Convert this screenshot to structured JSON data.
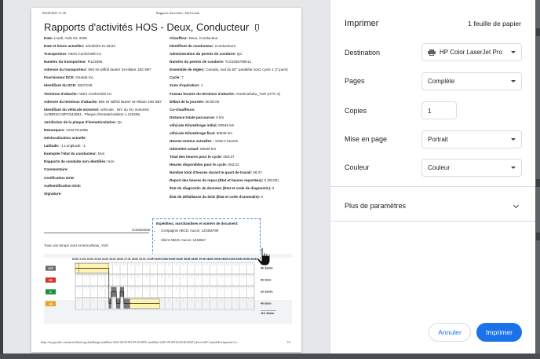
{
  "sheet": {
    "header_left": "04/08/2025 11:26",
    "header_center": "Rapports d'activités | MyGeotab",
    "title": "Rapports d'activités HOS - Deux, Conducteur",
    "left_rows": [
      {
        "k": "Date:",
        "v": " Lundi, Août 04, 2025"
      },
      {
        "k": "Date et heure actuelles:",
        "v": " 4/août/25 11:18:04"
      },
      {
        "k": "Transporteur:",
        "v": " AttriX Conformité inc"
      },
      {
        "k": "Numéro du transporteur:",
        "v": " R123456"
      },
      {
        "k": "Adresse du transporteur:",
        "v": " 894 sir wilfrid laurier St-Hilaire J3G 6B7"
      },
      {
        "k": "Fournisseur DCE:",
        "v": " Geotab Inc."
      },
      {
        "k": "Identifiant du DCE:",
        "v": " GEOTAB"
      },
      {
        "k": "Terminus d'attache:",
        "v": " AttriX Conformité inc"
      },
      {
        "k": "Adresse du terminus d'attache:",
        "v": " 894 sir wilfrid laurier St-Hilaire J3G 6B7"
      },
      {
        "k": "Identifiant du véhicule motorisé:",
        "v": " vehicule , NIV du VU motorisé: 1V2BR2CA9PC544681 , Plaque d'immatriculation: L123456,"
      },
      {
        "k": "Juridiction de la plaque d'immatriculation:",
        "v": " Qc"
      },
      {
        "k": "Remorques:",
        "v": " 1234-R12356"
      },
      {
        "k": "Géolocalisation actuelle:",
        "v": ""
      },
      {
        "k": "Latitude:",
        "v": " -1 Longitude: -1"
      },
      {
        "k": "Exempter l'état du conducteur:",
        "v": " Non"
      },
      {
        "k": "Rapports de conduite non identifiés:",
        "v": " Non"
      },
      {
        "k": "Commentaire:",
        "v": ""
      },
      {
        "k": "Certification DCE:",
        "v": ""
      },
      {
        "k": "Authentification DCE:",
        "v": ""
      },
      {
        "k": "Signature:",
        "v": ""
      }
    ],
    "right_rows": [
      {
        "k": "Chauffeur:",
        "v": " Deux, Conducteur"
      },
      {
        "k": "Identifiant du conducteur:",
        "v": " Conducteur2"
      },
      {
        "k": "Administration du permis de conduire:",
        "v": " QC"
      },
      {
        "k": "Numéro du permis de conduire:",
        "v": " T123456789012"
      },
      {
        "k": "Ensemble de règles:",
        "v": " Canada, sud du 60° parallèle nord, cycle 1 (7 jours)"
      },
      {
        "k": "Cycle:",
        "v": " 7"
      },
      {
        "k": "Zone d'opération:",
        "v": " 1"
      },
      {
        "k": "Fuseau horaire du terminus d'attache:",
        "v": " America/New_York (UTC-4)"
      },
      {
        "k": "Début de la journée:",
        "v": " 00:00:00"
      },
      {
        "k": "Co-chauffeurs:",
        "v": ""
      },
      {
        "k": "Distance totale parcourue:",
        "v": " 0 km"
      },
      {
        "k": "véhicule Kilométrage initial:",
        "v": " 60546 km"
      },
      {
        "k": "véhicule Kilométrage final:",
        "v": " 60546 km"
      },
      {
        "k": "Heures-moteur actuelles :",
        "v": " 1046.2 heures"
      },
      {
        "k": "Odomètre actuel:",
        "v": " 60546 km"
      },
      {
        "k": "Total des heures pour le cycle:",
        "v": " 006:37"
      },
      {
        "k": "Heures disponibles pour le cycle:",
        "v": " 063:22"
      },
      {
        "k": "Nombre total d'heures durant le quart de travail:",
        "v": " 06:37"
      },
      {
        "k": "Report des heures de repos (État et heures reportées):",
        "v": " 0 (00:00)"
      },
      {
        "k": "État du diagnostic de données (État et code de diagnostic):",
        "v": " 0"
      },
      {
        "k": "État de défaillance du DCE (État et code d'anomalie):",
        "v": " 0"
      }
    ],
    "shipper_title": "Expéditeur, marchandises et numéro de document:",
    "shipper_items": [
      "Compagnie ABCD, Aucun, 123456789",
      "Client ABCD, Aucun, 1234567"
    ],
    "conducteur_label": "Conducteur",
    "tz_note": "Tous ces temps sont America/New_York",
    "footer_left": "https://my.geotab.com/attrix/#hosLogs,dateRange:(endDate:'2025-08-05T03:59:59.000Z',startDate:'2025-08-04T04:00:00.000Z'),driver:b8C,includeExemptions:!t,o...",
    "footer_right": "1/2",
    "graph": {
      "hour_labels": [
        "00:00",
        "01:00",
        "02:00",
        "03:00",
        "04:00",
        "05:00",
        "06:00",
        "07:00",
        "08:00",
        "09:00",
        "10:00",
        "11:00",
        "12:00",
        "13:00",
        "14:00",
        "15:00",
        "16:00",
        "17:00",
        "18:00",
        "19:00",
        "20:00",
        "21:00",
        "22:00",
        "23:00",
        "24:00"
      ],
      "statuses": [
        {
          "label": "OFF",
          "color": "#6b6b6b",
          "total": "4h 32min"
        },
        {
          "label": "SB",
          "color": "#d93025",
          "total": "0h 0min"
        },
        {
          "label": "D",
          "color": "#1e8e3e",
          "total": "2h 32min"
        },
        {
          "label": "ON",
          "color": "#e6a117",
          "total": "4h 6min"
        }
      ],
      "grand_total": "11h 10min",
      "segments": [
        {
          "row": 0,
          "start": 0.0,
          "end": 0.5
        },
        {
          "row": 0,
          "start": 0.5,
          "end": 4.5
        },
        {
          "row": 3,
          "start": 4.5,
          "end": 4.8
        },
        {
          "row": 2,
          "start": 4.8,
          "end": 5.5
        },
        {
          "row": 3,
          "start": 5.5,
          "end": 6.0
        },
        {
          "row": 2,
          "start": 6.0,
          "end": 6.5
        },
        {
          "row": 3,
          "start": 6.5,
          "end": 7.3
        },
        {
          "row": 3,
          "start": 7.3,
          "end": 11.3
        }
      ]
    }
  },
  "panel": {
    "title": "Imprimer",
    "sheets_count": "1 feuille de papier",
    "destination_label": "Destination",
    "destination_value": "HP Color LaserJet Pro",
    "pages_label": "Pages",
    "pages_value": "Complète",
    "copies_label": "Copies",
    "copies_value": "1",
    "layout_label": "Mise en page",
    "layout_value": "Portrait",
    "color_label": "Couleur",
    "color_value": "Couleur",
    "more_settings": "Plus de paramètres",
    "cancel_label": "Annuler",
    "print_label": "Imprimer"
  }
}
